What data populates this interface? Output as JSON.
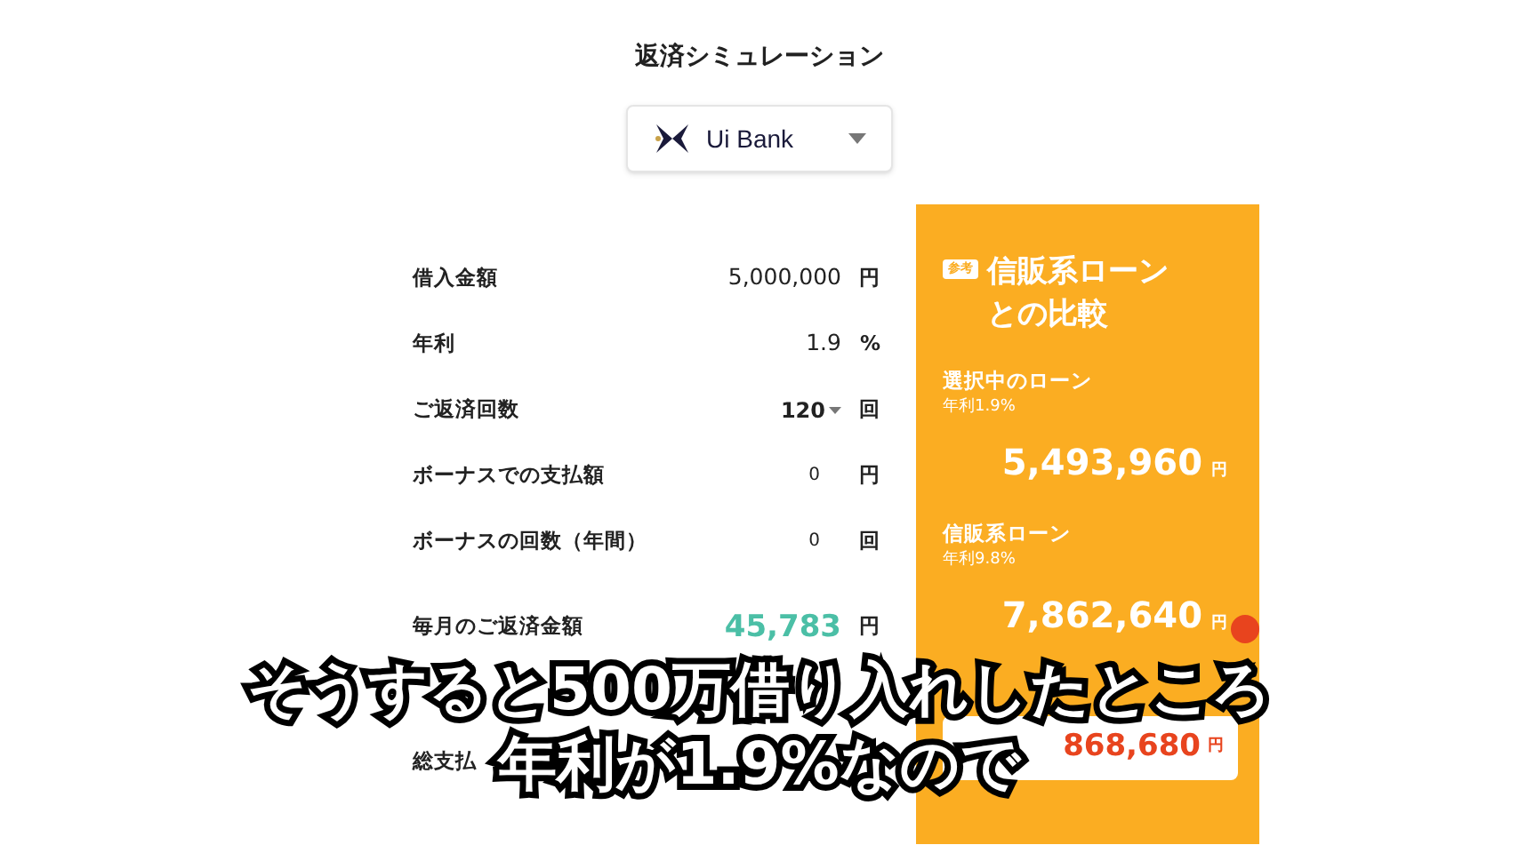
{
  "title": "返済シミュレーション",
  "bank_select": {
    "value": "Ui Bank"
  },
  "form_rows": [
    {
      "label": "借入金額",
      "value": "5,000,000",
      "unit": "円",
      "kind": "input"
    },
    {
      "label": "年利",
      "value": "1.9",
      "unit": "%",
      "kind": "input"
    },
    {
      "label": "ご返済回数",
      "value": "120",
      "unit": "回",
      "kind": "select"
    },
    {
      "label": "ボーナスでの支払額",
      "value": "0",
      "unit": "円",
      "kind": "input"
    },
    {
      "label": "ボーナスの回数（年間）",
      "value": "0",
      "unit": "回",
      "kind": "input"
    }
  ],
  "result_rows": [
    {
      "label": "毎月のご返済金額",
      "value": "45,783",
      "unit": "円"
    },
    {
      "label": "総支払"
    }
  ],
  "comparison": {
    "badge": "参考",
    "heading": "信販系ローンとの比較",
    "loans": [
      {
        "name": "選択中のローン",
        "rate": "年利1.9%",
        "total": "5,493,960",
        "unit": "円"
      },
      {
        "name": "信販系ローン",
        "rate": "年利9.8%",
        "total": "7,862,640",
        "unit": "円"
      }
    ],
    "difference": {
      "value": "868,680",
      "unit": "円"
    }
  },
  "subtitles": [
    "そうすると500万借り入れしたところ",
    "年利が1.9%なので"
  ]
}
